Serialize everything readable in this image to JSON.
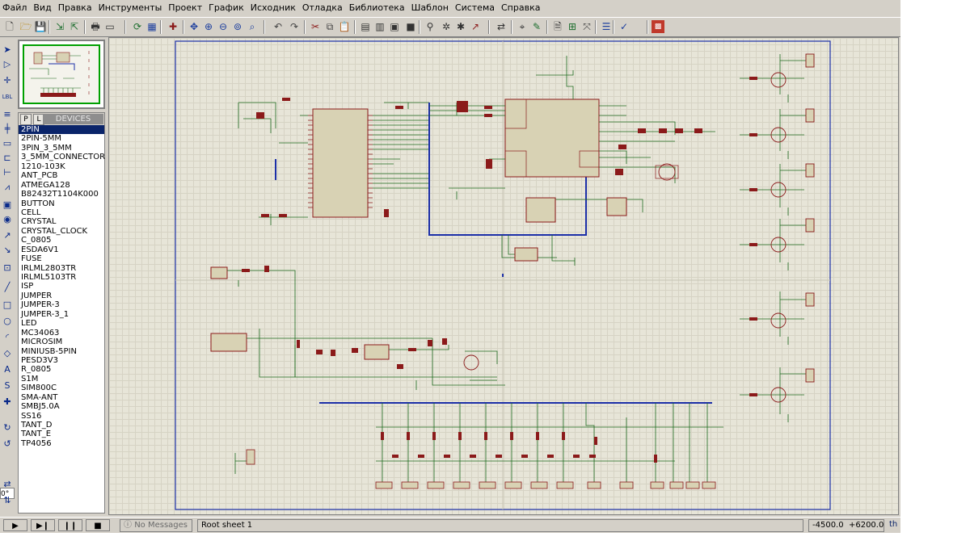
{
  "menu": [
    "Файл",
    "Вид",
    "Правка",
    "Инструменты",
    "Проект",
    "График",
    "Исходник",
    "Отладка",
    "Библиотека",
    "Шаблон",
    "Система",
    "Справка"
  ],
  "toolbar_icons": [
    "new-file-icon",
    "open-folder-icon",
    "save-icon",
    "import-icon",
    "export-icon",
    "print-icon",
    "print-area-icon",
    "refresh-icon",
    "grid-icon",
    "origin-icon",
    "pan-icon",
    "zoom-in-icon",
    "zoom-out-icon",
    "zoom-all-icon",
    "zoom-area-icon",
    "undo-icon",
    "redo-icon",
    "cut-icon",
    "copy-icon",
    "paste-icon",
    "block-copy-icon",
    "block-move-icon",
    "block-rotate-icon",
    "block-delete-icon",
    "pick-device-icon",
    "make-device-icon",
    "packaging-tool-icon",
    "decompose-icon",
    "wire-autorouter-icon",
    "search-tag-icon",
    "property-assignment-icon",
    "new-sheet-icon",
    "remove-sheet-icon",
    "zoom-to-child-icon",
    "bill-of-materials-icon",
    "electrical-rule-check-icon",
    "netlist-to-ares-icon"
  ],
  "left_tools": [
    "selection-mode-icon",
    "component-mode-icon",
    "junction-dot-icon",
    "wire-label-icon",
    "text-script-icon",
    "buses-icon",
    "subcircuit-icon",
    "terminals-icon",
    "device-pins-icon",
    "graph-icon",
    "tape-recorder-icon",
    "generator-icon",
    "voltage-probe-icon",
    "current-probe-icon",
    "virtual-instruments-icon",
    "line-2d-icon",
    "box-2d-icon",
    "circle-2d-icon",
    "arc-2d-icon",
    "path-2d-icon",
    "text-2d-icon",
    "symbol-icon",
    "marker-icon",
    "rotate-cw-icon",
    "rotate-ccw-icon",
    "mirror-x-icon",
    "mirror-y-icon"
  ],
  "rotation_value": "0°",
  "device_panel": {
    "tab_p": "P",
    "tab_l": "L",
    "title": "DEVICES",
    "items": [
      "2PIN",
      "2PIN-5MM",
      "3PIN_3_5MM",
      "3_5MM_CONNECTOR",
      "1210-103K",
      "ANT_PCB",
      "ATMEGA128",
      "B82432T1104K000",
      "BUTTON",
      "CELL",
      "CRYSTAL",
      "CRYSTAL_CLOCK",
      "C_0805",
      "ESDA6V1",
      "FUSE",
      "IRLML2803TR",
      "IRLML5103TR",
      "ISP",
      "JUMPER",
      "JUMPER-3",
      "JUMPER-3_1",
      "LED",
      "MC34063",
      "MICROSIM",
      "MINIUSB-5PIN",
      "PESD3V3",
      "R_0805",
      "S1M",
      "SIM800C",
      "SMA-ANT",
      "SMBJ5.0A",
      "SS16",
      "TANT_D",
      "TANT_E",
      "TP4056"
    ],
    "selected": "2PIN"
  },
  "status": {
    "messages": "No Messages",
    "sheet": "Root sheet 1",
    "coord_x": "-4500.0",
    "coord_y": "+6200.0",
    "units": "th"
  },
  "colors": {
    "wire": "#1f6b1f",
    "component": "#8b1a1a",
    "component_fill": "#d8d2b4",
    "bus": "#1c2fa8",
    "sheet_border": "#1c2fa8",
    "grid": "#d6d3c4",
    "canvas_bg": "#e7e5d8",
    "selection": "#0a246a"
  }
}
